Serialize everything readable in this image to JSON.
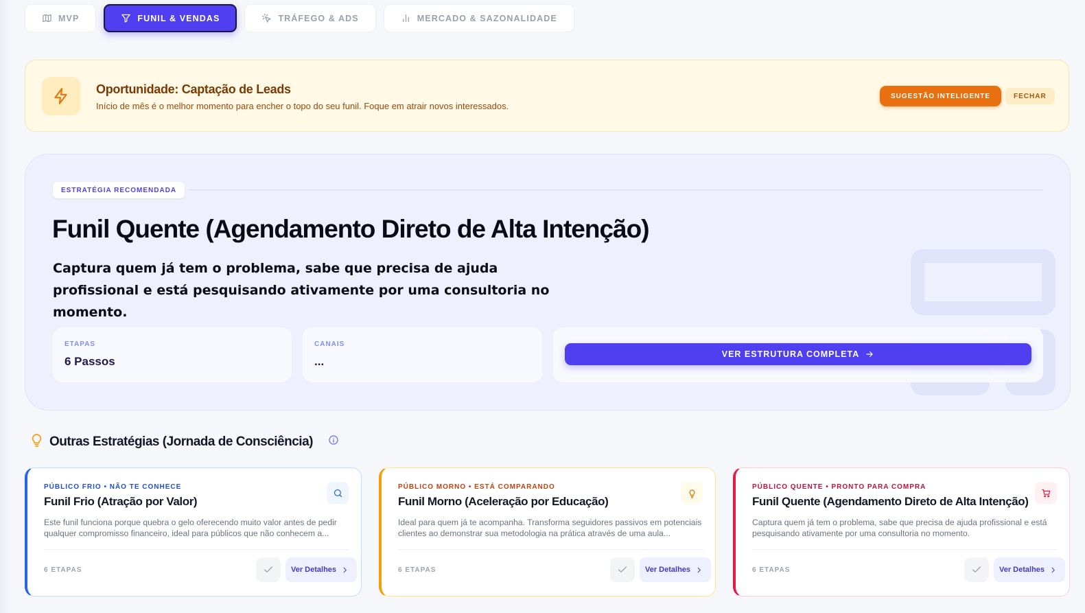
{
  "tabs": [
    {
      "label": "MVP",
      "icon": "map-icon",
      "active": false
    },
    {
      "label": "FUNIL & VENDAS",
      "icon": "funnel-icon",
      "active": true
    },
    {
      "label": "TRÁFEGO & ADS",
      "icon": "cursor-click-icon",
      "active": false
    },
    {
      "label": "MERCADO & SAZONALIDADE",
      "icon": "bar-chart-icon",
      "active": false
    }
  ],
  "banner": {
    "icon": "lightning-icon",
    "title": "Oportunidade: Captação de Leads",
    "subtitle": "Início de mês é o melhor momento para encher o topo do seu funil. Foque em atrair novos interessados.",
    "suggest_label": "SUGESTÃO INTELIGENTE",
    "close_label": "FECHAR",
    "colors": {
      "accent": "#e8700f",
      "background": "#fff9e6"
    }
  },
  "hero": {
    "badge": "ESTRATÉGIA RECOMENDADA",
    "title": "Funil Quente (Agendamento Direto de Alta Intenção)",
    "description": "Captura quem já tem o problema, sabe que precisa de ajuda profissional e está pesquisando ativamente por uma consultoria no momento.",
    "stats": {
      "etapas_label": "ETAPAS",
      "etapas_value": "6 Passos",
      "canais_label": "CANAIS",
      "canais_value": "..."
    },
    "cta_label": "VER ESTRUTURA COMPLETA",
    "colors": {
      "primary": "#4f3ff0",
      "background": "#eef0fd"
    }
  },
  "section": {
    "title": "Outras Estratégias (Jornada de Consciência)",
    "icon": "lightbulb-icon",
    "info_icon": "info-icon"
  },
  "cards": [
    {
      "tag": "PÚBLICO FRIO • NÃO TE CONHECE",
      "title": "Funil Frio (Atração por Valor)",
      "description": "Este funil funciona porque quebra o gelo oferecendo muito valor antes de pedir qualquer compromisso financeiro, ideal para públicos que não conhecem a...",
      "steps": "6 ETAPAS",
      "details_label": "Ver Detalhes",
      "icon": "search-icon",
      "color": "#2563eb"
    },
    {
      "tag": "PÚBLICO MORNO • ESTÁ COMPARANDO",
      "title": "Funil Morno (Aceleração por Educação)",
      "description": "Ideal para quem já te acompanha. Transforma seguidores passivos em potenciais clientes ao demonstrar sua metodologia na prática através de uma aula...",
      "steps": "6 ETAPAS",
      "details_label": "Ver Detalhes",
      "icon": "lightbulb-icon",
      "color": "#f59e0b"
    },
    {
      "tag": "PÚBLICO QUENTE • PRONTO PARA COMPRA",
      "title": "Funil Quente (Agendamento Direto de Alta Intenção)",
      "description": "Captura quem já tem o problema, sabe que precisa de ajuda profissional e está pesquisando ativamente por uma consultoria no momento.",
      "steps": "6 ETAPAS",
      "details_label": "Ver Detalhes",
      "icon": "shopping-cart-icon",
      "color": "#e11d48"
    }
  ]
}
